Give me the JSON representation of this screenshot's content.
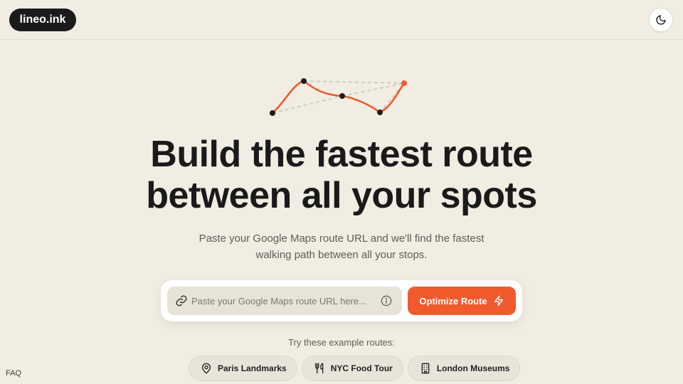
{
  "header": {
    "logo": "lineo.ink",
    "theme_toggle_icon": "moon-icon"
  },
  "hero": {
    "title_line1": "Build the fastest route",
    "title_line2": "between all your spots",
    "subtitle_line1": "Paste your Google Maps route URL and we'll find the fastest",
    "subtitle_line2": "walking path between all your stops."
  },
  "form": {
    "placeholder": "Paste your Google Maps route URL here...",
    "value": "",
    "button_label": "Optimize Route",
    "button_icon": "zap-icon"
  },
  "examples": {
    "label": "Try these example routes:",
    "chips": [
      {
        "label": "Paris Landmarks",
        "icon": "map-pin-icon"
      },
      {
        "label": "NYC Food Tour",
        "icon": "utensils-icon"
      },
      {
        "label": "London Museums",
        "icon": "building-icon"
      }
    ]
  },
  "footer": {
    "faq": "FAQ"
  },
  "colors": {
    "accent": "#f15a2c",
    "background": "#f1ede3",
    "dark": "#1b1b1b"
  }
}
